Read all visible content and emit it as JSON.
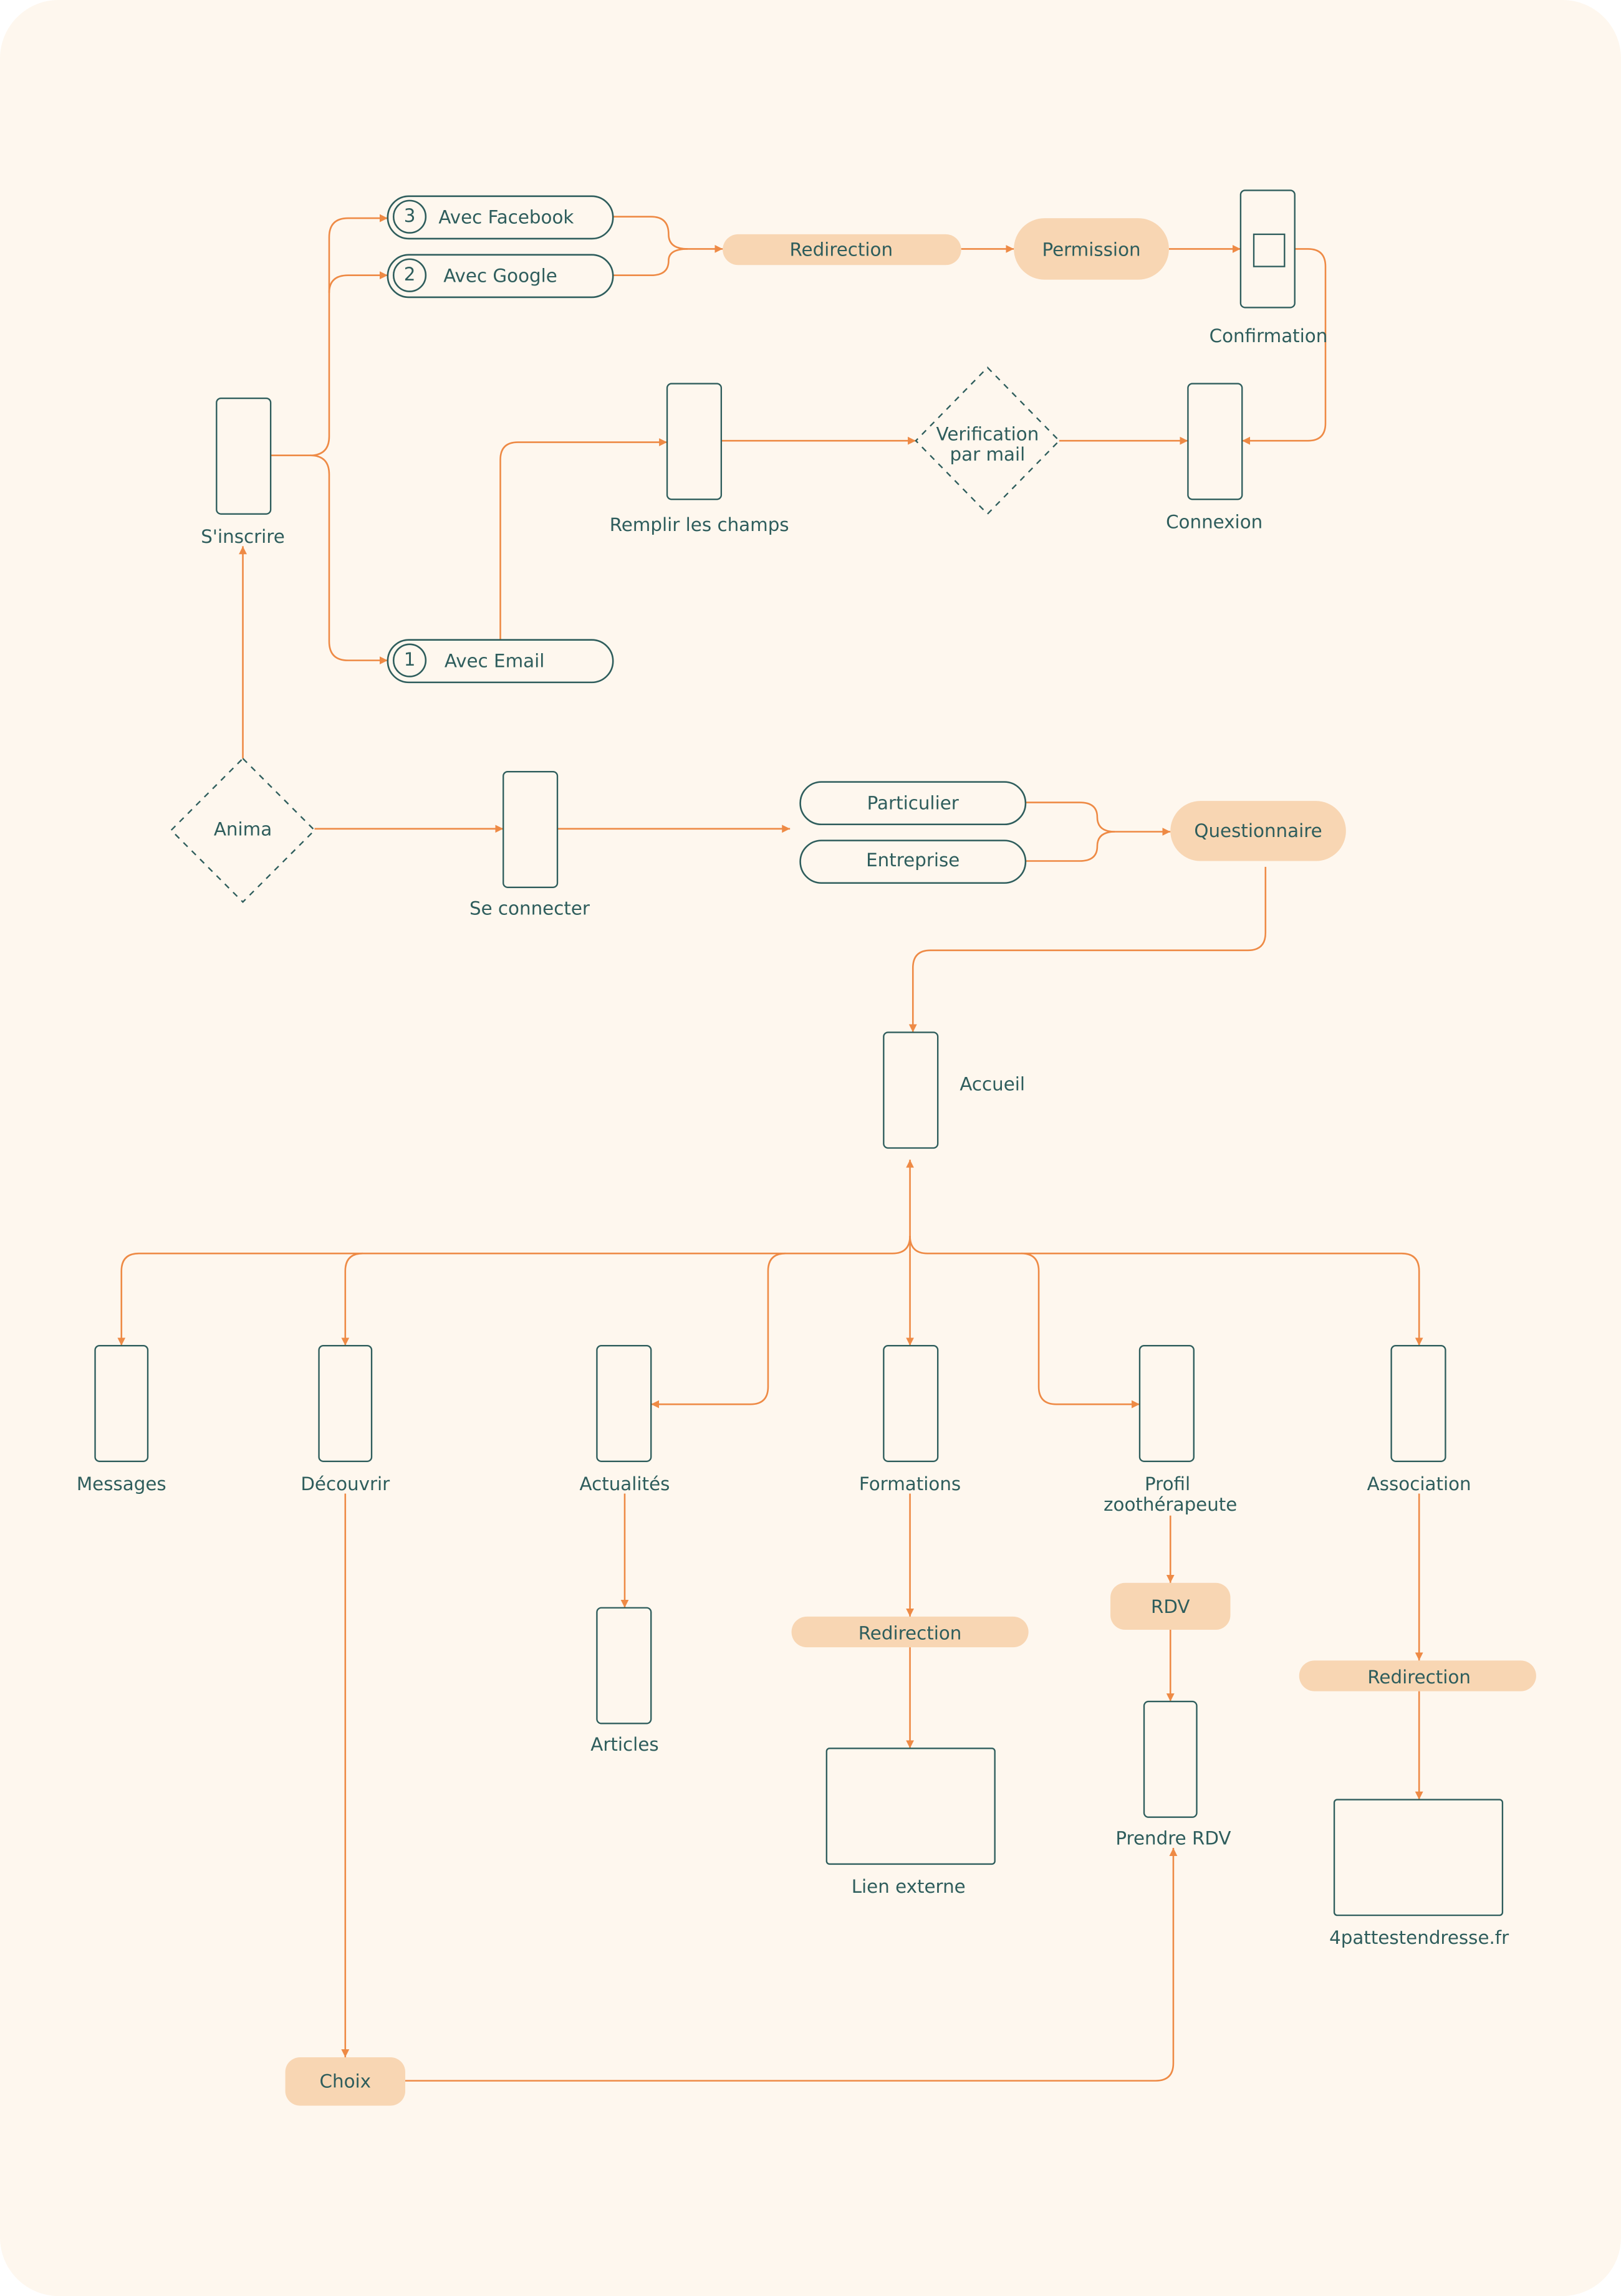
{
  "colors": {
    "background": "#FEF7EE",
    "connector": "#EE8A45",
    "node_outline": "#2E5D5C",
    "action_fill": "#F8D6B3",
    "text": "#2E5D5C"
  },
  "signup": {
    "screen_label": "S'inscrire",
    "options": [
      {
        "number": "3",
        "label": "Avec Facebook"
      },
      {
        "number": "2",
        "label": "Avec Google"
      },
      {
        "number": "1",
        "label": "Avec Email"
      }
    ],
    "redirection": "Redirection",
    "permission": "Permission",
    "confirmation": "Confirmation",
    "fill_fields": "Remplir les champs",
    "verification": [
      "Verification",
      "par mail"
    ],
    "login_screen": "Connexion"
  },
  "start": {
    "app": "Anima",
    "login": "Se connecter",
    "profiles": [
      "Particulier",
      "Entreprise"
    ],
    "questionnaire": "Questionnaire"
  },
  "home": {
    "label": "Accueil"
  },
  "sections": {
    "messages": "Messages",
    "discover": "Découvrir",
    "news": "Actualités",
    "trainings": "Formations",
    "profile": [
      "Profil",
      "zoothérapeute"
    ],
    "association": "Association"
  },
  "subflows": {
    "articles": "Articles",
    "redirection_trainings": "Redirection",
    "external_link": "Lien externe",
    "rdv": "RDV",
    "book_rdv": "Prendre RDV",
    "redirection_association": "Redirection",
    "association_site": "4pattestendresse.fr",
    "choice": "Choix"
  }
}
